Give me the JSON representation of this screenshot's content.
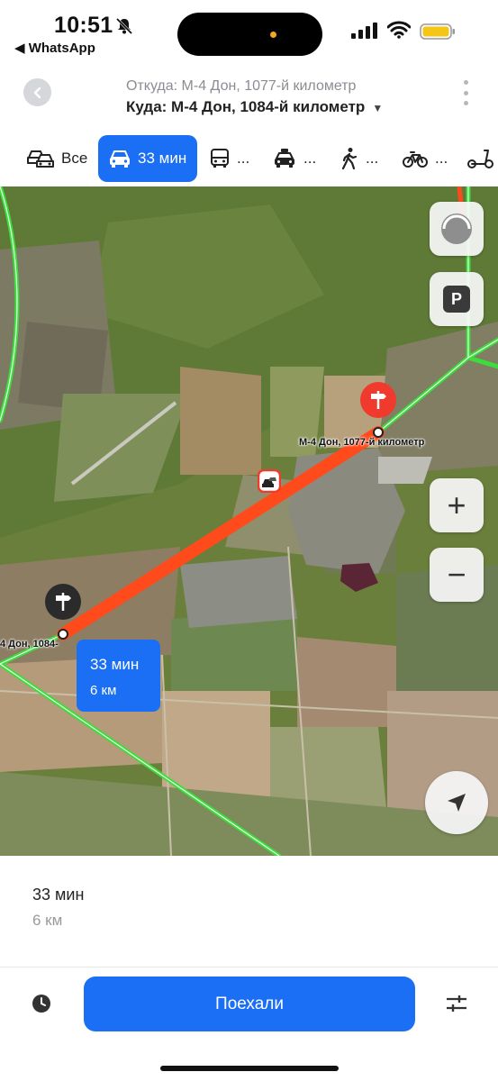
{
  "status_bar": {
    "time": "10:51",
    "back_app": "◀ WhatsApp"
  },
  "route": {
    "from": "Откуда: М-4 Дон, 1077-й километр",
    "to": "Куда: М-4 Дон, 1084-й километр",
    "to_caret": "▼"
  },
  "modes": [
    {
      "label": "Все",
      "icon": "cars-icon"
    },
    {
      "label": "33 мин",
      "icon": "car-icon",
      "active": true
    },
    {
      "label": "...",
      "icon": "bus-icon"
    },
    {
      "label": "...",
      "icon": "taxi-icon"
    },
    {
      "label": "...",
      "icon": "walking-icon"
    },
    {
      "label": "...",
      "icon": "bicycle-icon"
    },
    {
      "label": "",
      "icon": "scooter-icon"
    }
  ],
  "map": {
    "start_label": "М-4 Дон, 1077-й километр",
    "end_label": "4 Дон, 1084-",
    "callout": {
      "time": "33 мин",
      "distance": "6 км"
    },
    "buttons": {
      "parking": "P",
      "zoom_in": "+",
      "zoom_out": "−"
    }
  },
  "summary": {
    "time": "33 мин",
    "distance": "6 км"
  },
  "go_button": "Поехали",
  "colors": {
    "accent": "#1a6ff5",
    "route": "#ff4a1c",
    "traffic_free": "#3ddc3d",
    "pin": "#f03a2e"
  }
}
